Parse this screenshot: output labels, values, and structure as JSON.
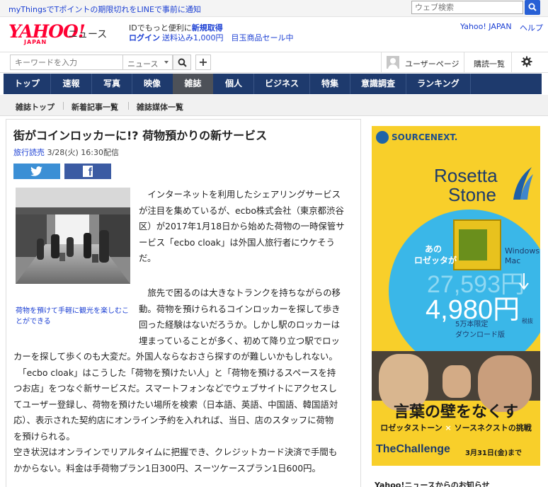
{
  "top_bar": {
    "promo_link": "myThingsでTポイントの期限切れをLINEで事前に通知",
    "search_placeholder": "ウェブ検索"
  },
  "header": {
    "logo_text": "YAHOO!",
    "logo_sub": "JAPAN",
    "section_label": "ニュース",
    "tagline_prefix": "IDでもっと便利に",
    "tagline_link": "新規取得",
    "login": "ログイン",
    "promo": "送料込み1,000円　目玉商品セール中",
    "yahoo_japan": "Yahoo! JAPAN",
    "help": "ヘルプ"
  },
  "search": {
    "placeholder": "キーワードを入力",
    "scope": "ニュース",
    "add_label": "+",
    "user_page": "ユーザーページ",
    "subscriptions": "購読一覧"
  },
  "nav": {
    "items": [
      "トップ",
      "速報",
      "写真",
      "映像",
      "雑誌",
      "個人",
      "ビジネス",
      "特集",
      "意識調査",
      "ランキング"
    ],
    "active": "雑誌"
  },
  "subnav": {
    "items": [
      "雑誌トップ",
      "新着記事一覧",
      "雑誌媒体一覧"
    ]
  },
  "article": {
    "title": "街がコインロッカーに!? 荷物預かりの新サービス",
    "source": "旅行読売",
    "date": "3/28(火) 16:30配信",
    "photo_caption": "荷物を預けて手軽に観光を楽しむことができる",
    "para1": [
      "　インターネットを利用したシェアリングサービス",
      "が注目を集めているが、ecbo株式会社（東京都渋谷",
      "区）が2017年1月18日から始めた荷物の一時保管サ",
      "ービス「ecbo cloak」は外国人旅行者にウケそう",
      "だ。"
    ],
    "para2_narrow": [
      "　旅先で困るのは大きなトランクを持ちながらの移",
      "動。荷物を預けられるコインロッカーを探して歩き",
      "回った経験はないだろうか。しかし駅のロッカーは",
      "埋まっていることが多く、初めて降り立つ駅でロッ"
    ],
    "body_full": [
      "カーを探して歩くのも大変だ。外国人ならなおさら探すのが難しいかもしれない。",
      "　「ecbo cloak」はこうした「荷物を預けたい人」と「荷物を預けるスペースを持",
      "つお店」をつなぐ新サービスだ。スマートフォンなどでウェブサイトにアクセスし",
      "てユーザー登録し、荷物を預けたい場所を検索（日本語、英語、中国語、韓国語対",
      "応）、表示された契約店にオンライン予約を入れれば、当日、店のスタッフに荷物",
      "を預けられる。",
      "空き状況はオンラインでリアルタイムに把握でき、クレジットカード決済で手間も",
      "かからない。料金は手荷物プラン1日300円、スーツケースプラン1日600円。"
    ]
  },
  "ad": {
    "brand": "SOURCENEXT.",
    "product_line1": "Rosetta",
    "product_line2": "Stone",
    "ano": "あの",
    "rosetta_jp": "ロゼッタが",
    "windows": "Windows",
    "mac": "Mac",
    "old_price": "27,593円",
    "new_price": "4,980円",
    "tax": "税抜",
    "limited": "5万本限定",
    "download": "ダウンロード版",
    "slogan": "言葉の壁をなくす",
    "sub_left": "ロゼッタストーン",
    "sub_x": "×",
    "sub_right": "ソースネクストの挑戦",
    "challenge": "TheChallenge",
    "date": "3月31日(金)まで"
  },
  "sidebar": {
    "heading": "Yahoo!ニュースからのお知らせ"
  },
  "colors": {
    "nav_bg": "#1e3a6d",
    "nav_active": "#4d5158",
    "link": "#1b3fd3",
    "ad_bg": "#f8cf2a",
    "twitter": "#3b8fd5",
    "facebook": "#3b5ba3"
  }
}
